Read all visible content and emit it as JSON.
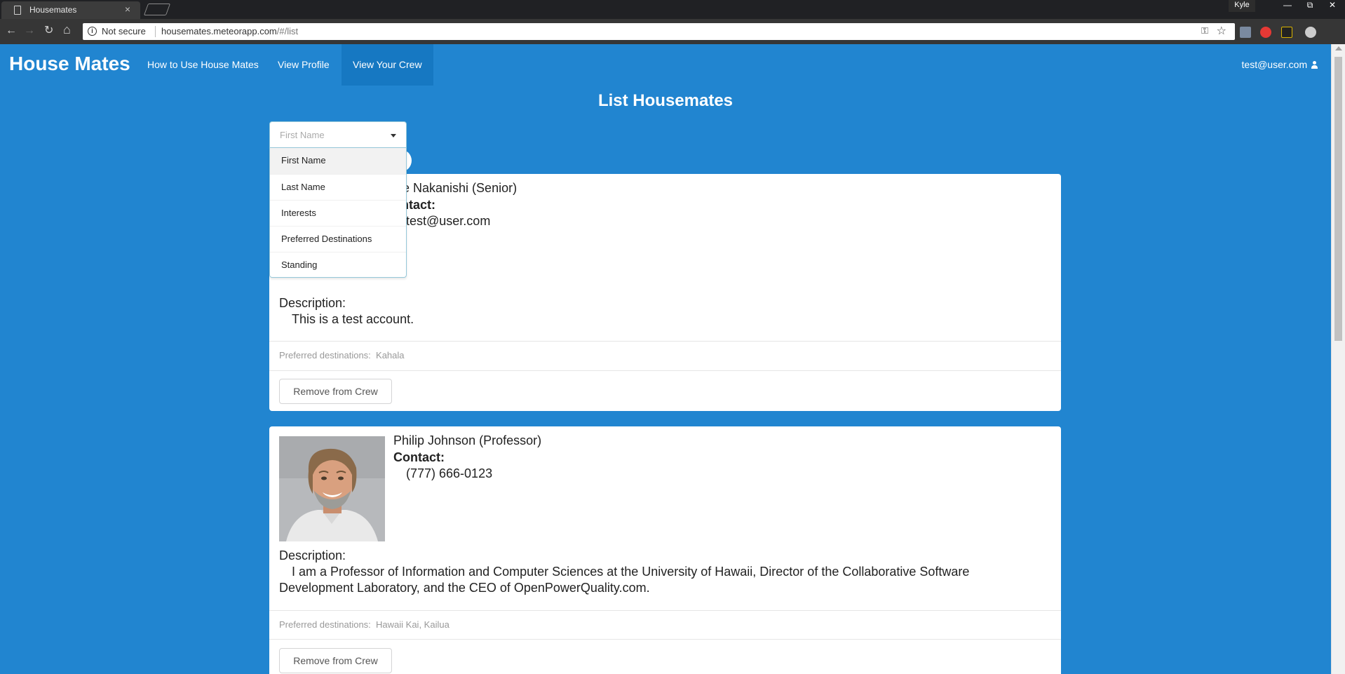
{
  "browser": {
    "tab_title": "Housemates",
    "tab_close": "×",
    "profile_name": "Kyle",
    "win_minimize": "—",
    "win_restore": "⧉",
    "win_close": "✕",
    "security_label": "Not secure",
    "url_domain": "housemates.meteorapp.com",
    "url_path": "/#/list",
    "back_icon": "←",
    "forward_icon": "→",
    "reload_icon": "↻",
    "home_icon": "⌂",
    "key_icon": "⚿",
    "star_icon": "☆",
    "extension_colors": [
      "#7a8aa0",
      "#e53935",
      "#222222",
      "#cccccc"
    ]
  },
  "navbar": {
    "brand": "House Mates",
    "links": [
      "How to Use House Mates",
      "View Profile",
      "View Your Crew"
    ],
    "active_link": "View Your Crew",
    "user": "test@user.com"
  },
  "page_title": "List Housemates",
  "filter": {
    "placeholder": "First Name",
    "options": [
      "First Name",
      "Last Name",
      "Interests",
      "Preferred Destinations",
      "Standing"
    ],
    "highlighted": "First Name"
  },
  "housemates": [
    {
      "name": "Kyle Nakanishi (Senior)",
      "name_visible": "yle Nakanishi (Senior)",
      "contact_label": "Contact:",
      "contact_label_visible": "ontact:",
      "contact": "test@user.com",
      "description_label": "Description:",
      "description": "This is a test account.",
      "destinations_label": "Preferred destinations:",
      "destinations": "Kahala",
      "button": "Remove from Crew"
    },
    {
      "name": "Philip Johnson (Professor)",
      "contact_label": "Contact:",
      "contact": "(777) 666-0123",
      "description_label": "Description:",
      "description": "I am a Professor of Information and Computer Sciences at the University of Hawaii, Director of the Collaborative Software Development Laboratory, and the CEO of OpenPowerQuality.com.",
      "destinations_label": "Preferred destinations:",
      "destinations": "Hawaii Kai, Kailua",
      "button": "Remove from Crew"
    }
  ],
  "colors": {
    "page_bg": "#2185d0",
    "active_nav": "#1678c2",
    "avatar_yellow": "#fbd800"
  }
}
